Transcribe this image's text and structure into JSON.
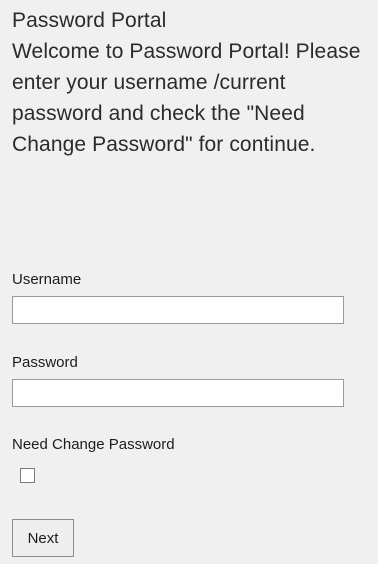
{
  "page": {
    "title": "Password Portal",
    "intro": "Welcome to Password Portal! Please enter your username /current password and check the \"Need Change Password\" for continue."
  },
  "form": {
    "username": {
      "label": "Username",
      "value": ""
    },
    "password": {
      "label": "Password",
      "value": ""
    },
    "need_change": {
      "label": "Need Change Password",
      "checked": false
    },
    "submit_label": "Next"
  },
  "colors": {
    "background": "#f0f0f0",
    "text": "#2b2b2b",
    "input_border": "#9a9a9a"
  }
}
